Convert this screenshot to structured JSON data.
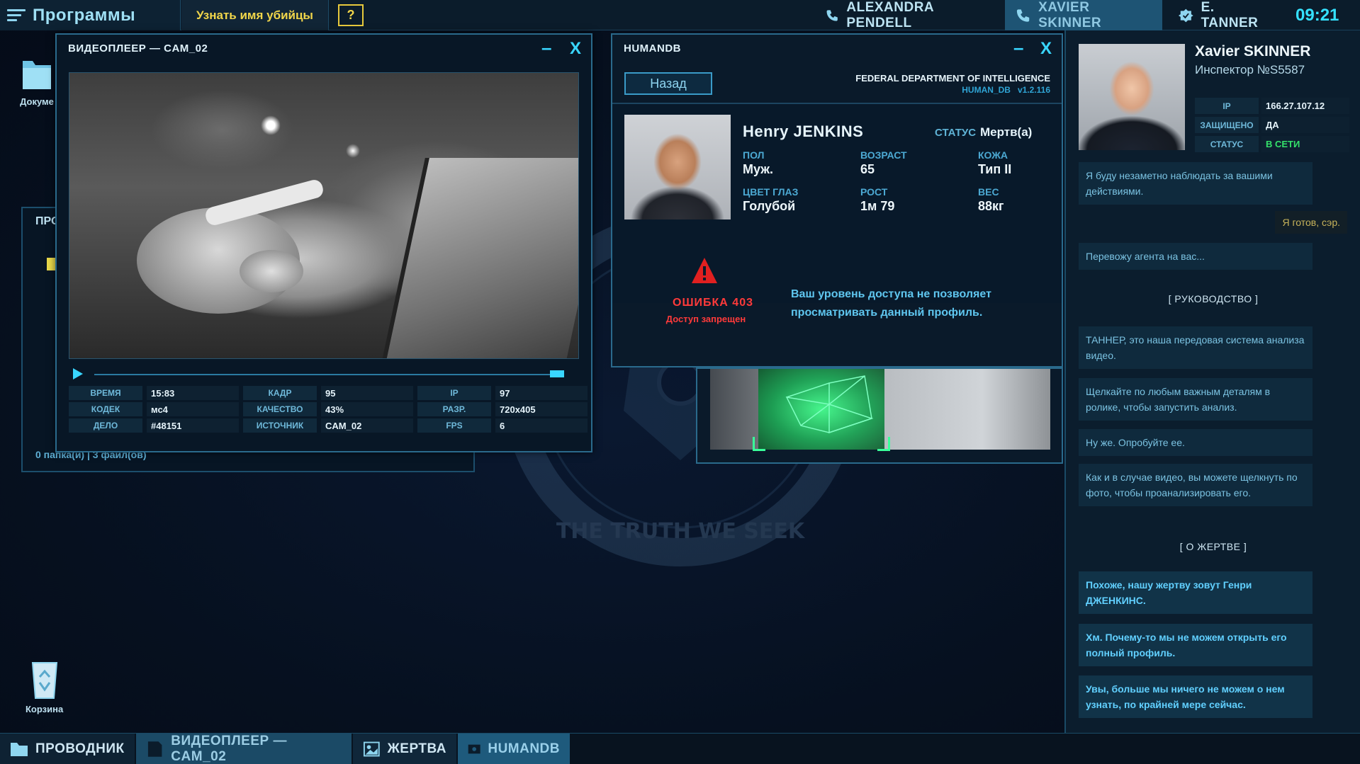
{
  "topbar": {
    "programs_label": "Программы",
    "killer_button": "Узнать имя убийцы",
    "help_button": "?",
    "contacts": [
      {
        "name": "ALEXANDRA PENDELL"
      },
      {
        "name": "XAVIER SKINNER"
      },
      {
        "name": "E. TANNER"
      }
    ],
    "clock": "09:21"
  },
  "desktop": {
    "icons": [
      {
        "label": "Докуме",
        "icon": "folder-icon"
      },
      {
        "label": "Корзина",
        "icon": "recycle-bin-icon"
      }
    ]
  },
  "explorer": {
    "title": "ПРО",
    "status": "0 папка(и)   |   3 файл(ов)"
  },
  "emblem": {
    "motto": "THE TRUTH WE SEEK"
  },
  "video": {
    "title": "ВИДЕОПЛЕЕР — CAM_02",
    "minimize": "–",
    "close": "X",
    "meta": [
      {
        "key": "ВРЕМЯ",
        "value": "15:83"
      },
      {
        "key": "КАДР",
        "value": "95"
      },
      {
        "key": "IP",
        "value": "97"
      },
      {
        "key": "КОДЕК",
        "value": "мс4"
      },
      {
        "key": "КАЧЕСТВО",
        "value": "43%"
      },
      {
        "key": "РАЗР.",
        "value": "720x405"
      },
      {
        "key": "ДЕЛО",
        "value": "#48151"
      },
      {
        "key": "ИСТОЧНИК",
        "value": "CAM_02"
      },
      {
        "key": "FPS",
        "value": "6"
      }
    ],
    "progress": 0.99
  },
  "humandb": {
    "title": "HUMANDB",
    "minimize": "–",
    "close": "X",
    "back_button": "Назад",
    "agency": "FEDERAL DEPARTMENT OF INTELLIGENCE",
    "db_name": "HUMAN_DB",
    "version": "v1.2.116",
    "name": "Henry  JENKINS",
    "status_key": "СТАТУС",
    "status_value": "Мертв(а)",
    "attributes": [
      {
        "key": "ПОЛ",
        "value": "Муж."
      },
      {
        "key": "ВОЗРАСТ",
        "value": "65"
      },
      {
        "key": "КОЖА",
        "value": "Тип II"
      },
      {
        "key": "ЦВЕТ ГЛАЗ",
        "value": "Голубой"
      },
      {
        "key": "РОСТ",
        "value": "1м 79"
      },
      {
        "key": "ВЕС",
        "value": "88кг"
      }
    ],
    "error_code": "ОШИБКА 403",
    "error_text": "Доступ запрещен",
    "message": "Ваш уровень доступа не позволяет просматривать данный профиль."
  },
  "sidebar": {
    "agent_name": "Xavier SKINNER",
    "agent_rank": "Инспектор №S5587",
    "agent_info": [
      {
        "key": "IP",
        "value": "166.27.107.12"
      },
      {
        "key": "ЗАЩИЩЕНО",
        "value": "ДА"
      },
      {
        "key": "СТАТУС",
        "value": "В СЕТИ"
      }
    ],
    "status_color": "#34e06a",
    "chat": {
      "m1": "Я буду незаметно наблюдать за вашими действиями.",
      "self1": "Я готов, сэр.",
      "m2": "Перевожу агента на вас...",
      "section1": "[   РУКОВОДСТВО   ]",
      "m3": "ТАННЕР, это наша передовая система анализа видео.",
      "m4": "Щелкайте по любым важным деталям в ролике, чтобы запустить анализ.",
      "m5": "Ну же. Опробуйте ее.",
      "m6": "Как и в случае видео, вы можете щелкнуть по фото, чтобы проанализировать его.",
      "section2": "[   О ЖЕРТВЕ   ]",
      "m7": "Похоже, нашу жертву зовут Генри ДЖЕНКИНС.",
      "m8": "Хм. Почему-то мы не можем открыть его полный профиль.",
      "m9": "Увы, больше мы ничего не можем о нем узнать, по крайней мере сейчас."
    }
  },
  "taskbar": {
    "items": [
      {
        "label": "ПРОВОДНИК"
      },
      {
        "label": "ВИДЕОПЛЕЕР — CAM_02"
      },
      {
        "label": "ЖЕРТВА"
      },
      {
        "label": "HUMANDB"
      }
    ]
  },
  "colors": {
    "accent": "#39d6ff",
    "warning": "#ff3a3a",
    "highlight": "#f1d64a"
  }
}
